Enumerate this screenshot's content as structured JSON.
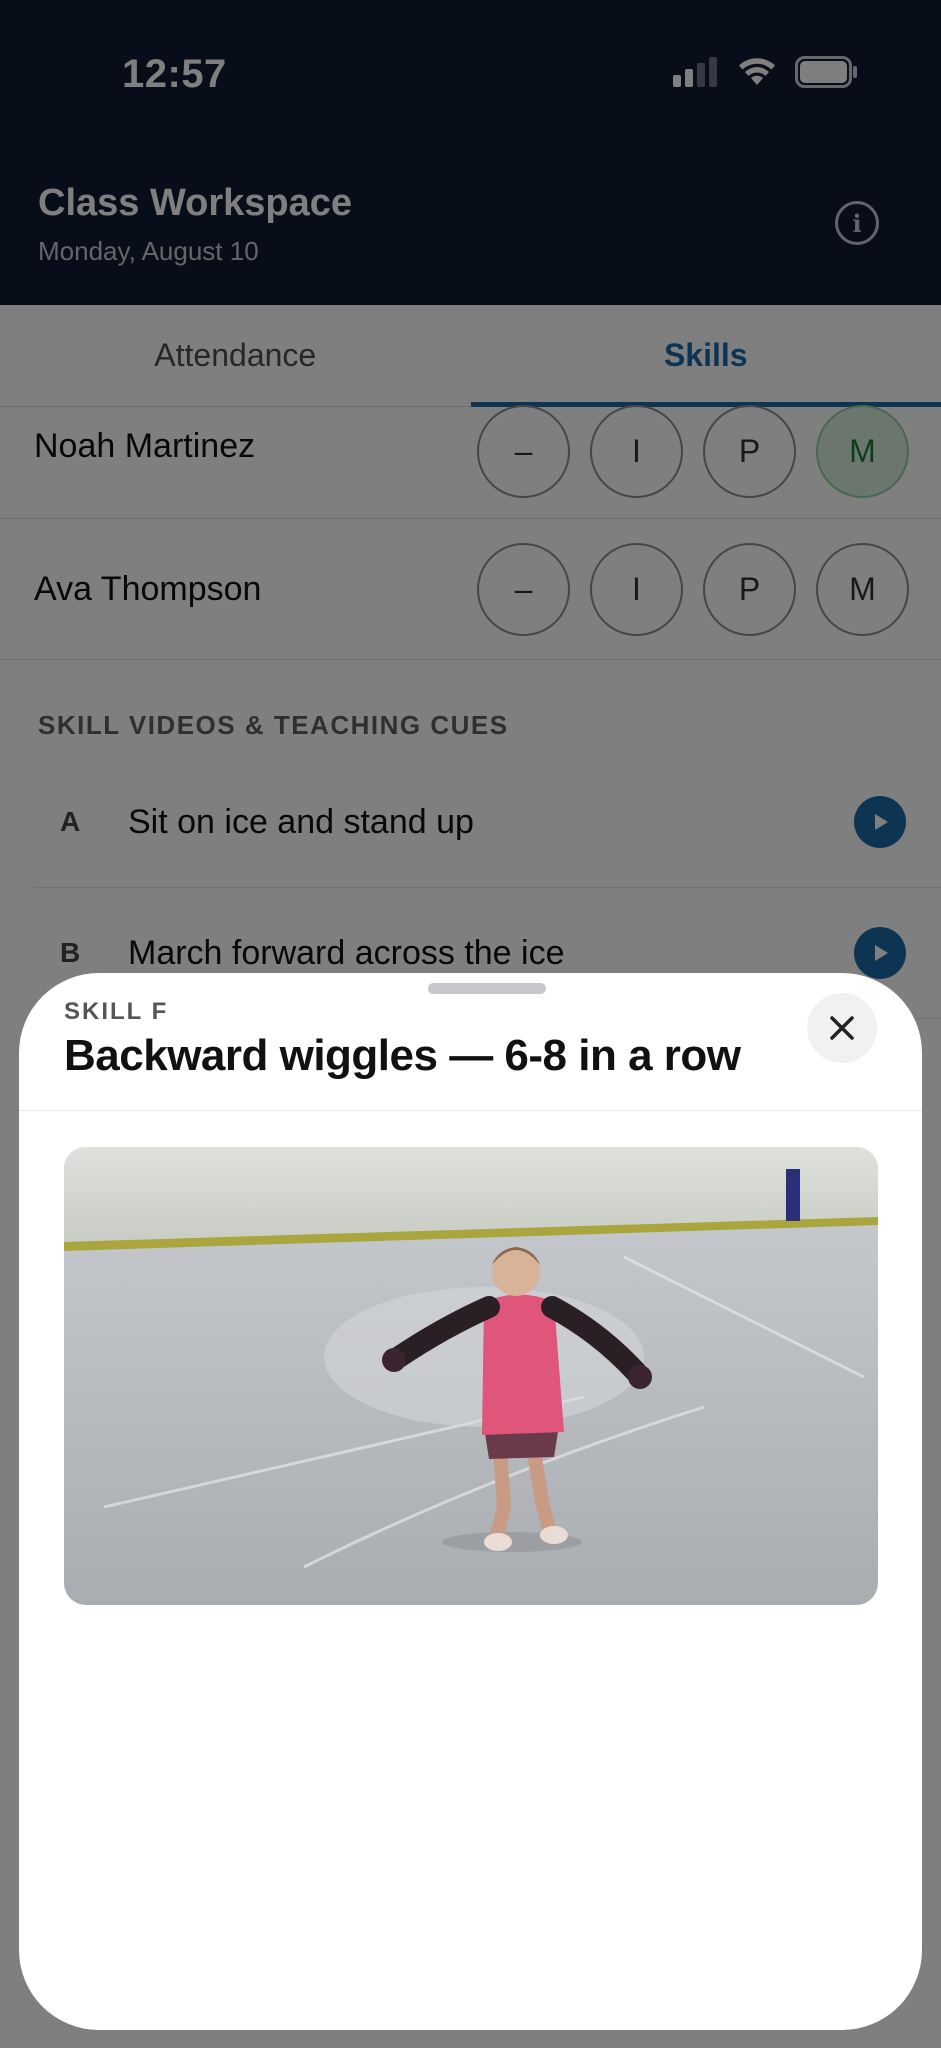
{
  "status_bar": {
    "time": "12:57"
  },
  "header": {
    "title": "Class Workspace",
    "subtitle": "Monday, August 10"
  },
  "tabs": [
    {
      "label": "Attendance",
      "active": false
    },
    {
      "label": "Skills",
      "active": true
    }
  ],
  "students": [
    {
      "name": "Noah Martinez",
      "grades": [
        "–",
        "I",
        "P",
        "M"
      ],
      "selected": "M"
    },
    {
      "name": "Ava Thompson",
      "grades": [
        "–",
        "I",
        "P",
        "M"
      ],
      "selected": null
    }
  ],
  "skills_section": {
    "label": "SKILL VIDEOS & TEACHING CUES",
    "items": [
      {
        "letter": "A",
        "text": "Sit on ice and stand up"
      },
      {
        "letter": "B",
        "text": "March forward across the ice"
      }
    ]
  },
  "modal": {
    "eyebrow": "SKILL F",
    "title": "Backward wiggles — 6-8 in a row"
  },
  "colors": {
    "header_bg": "#0f1d33",
    "accent": "#1b6aa6",
    "selected_grade": "#d7efdd"
  }
}
